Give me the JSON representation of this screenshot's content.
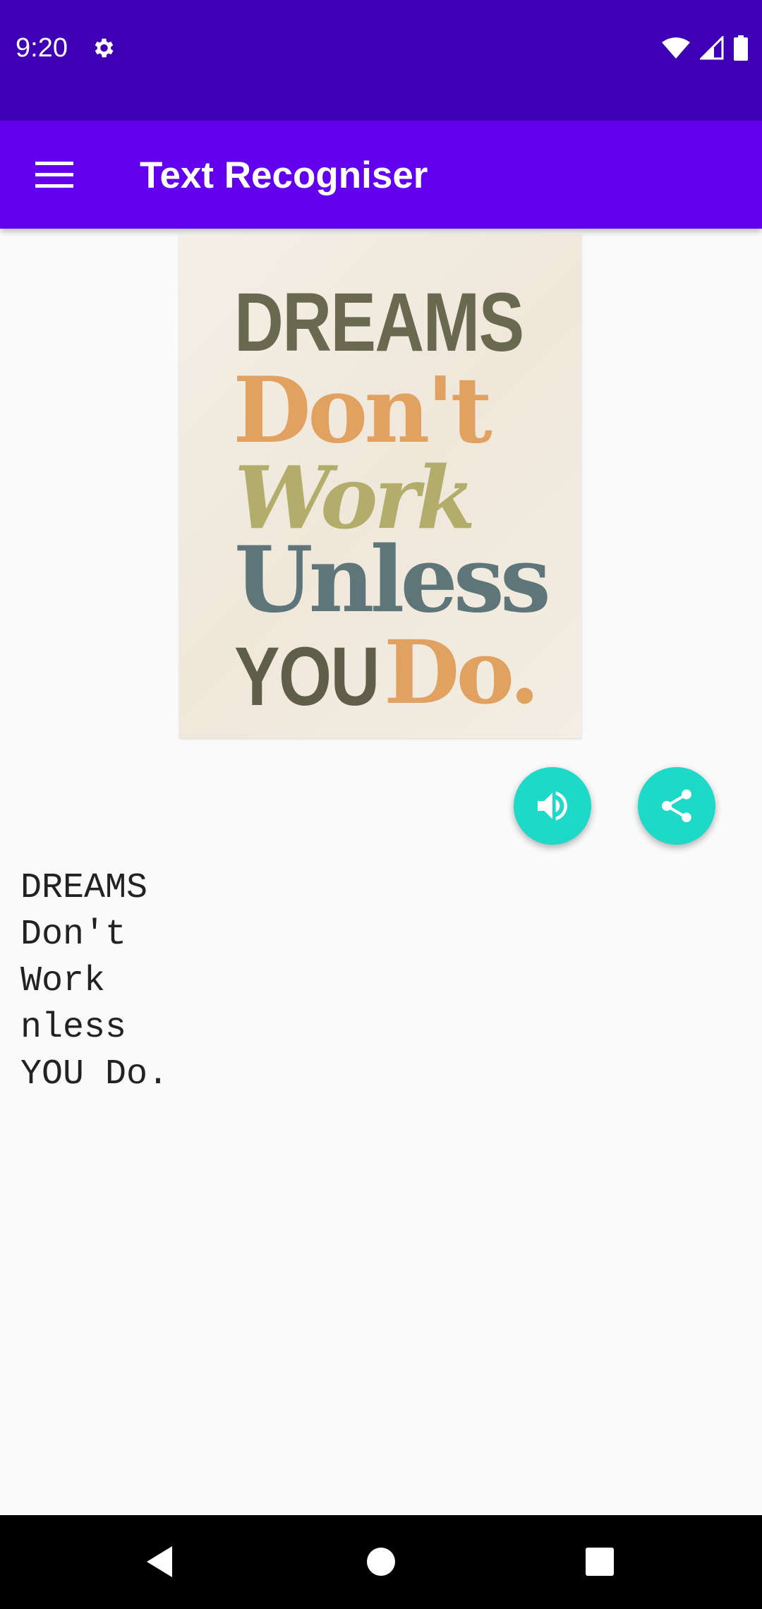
{
  "status_bar": {
    "time": "9:20",
    "icons": [
      "gear-icon",
      "wifi-icon",
      "signal-icon",
      "battery-icon"
    ]
  },
  "app_bar": {
    "title": "Text Recogniser",
    "menu_icon": "hamburger-menu-icon"
  },
  "poster": {
    "lines": [
      "DREAMS",
      "Don't",
      "Work",
      "Unless",
      "YOU",
      "Do."
    ]
  },
  "actions": {
    "speak_icon": "volume-up-icon",
    "share_icon": "share-icon",
    "accent_color": "#1dd9c8"
  },
  "recognized_text": "DREAMS\nDon't\nWork\nnless\nYOU Do.",
  "nav_bar": {
    "icons": [
      "back-icon",
      "home-icon",
      "recents-icon"
    ]
  },
  "colors": {
    "status_bar": "#3f00b5",
    "app_bar": "#6200ee",
    "background": "#fafafa"
  }
}
